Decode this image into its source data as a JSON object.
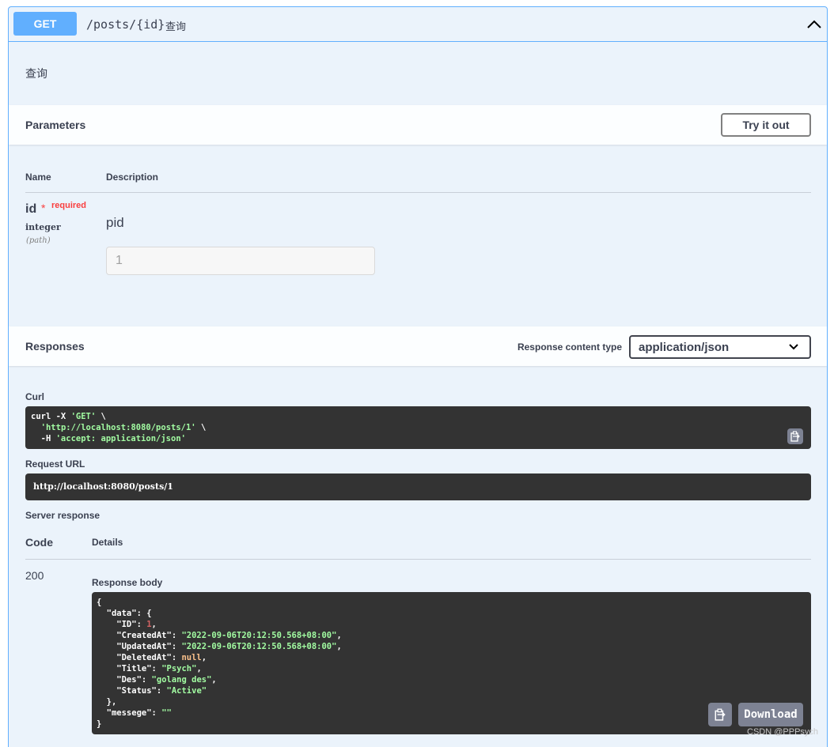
{
  "operation": {
    "method": "GET",
    "path": "/posts/{id}",
    "summary": "查询",
    "description": "查询"
  },
  "parameters": {
    "title": "Parameters",
    "try_it_out": "Try it out",
    "col_name": "Name",
    "col_description": "Description",
    "items": [
      {
        "name": "id",
        "required_star": "*",
        "required_label": "required",
        "type": "integer",
        "in": "(path)",
        "description": "pid",
        "value": "1"
      }
    ]
  },
  "responses": {
    "title": "Responses",
    "content_type_label": "Response content type",
    "content_type": "application/json",
    "curl_label": "Curl",
    "curl_line1_a": "curl -X ",
    "curl_line1_b": "'GET'",
    "curl_line1_c": " \\",
    "curl_line2_a": "  ",
    "curl_line2_b": "'http://localhost:8080/posts/1'",
    "curl_line2_c": " \\",
    "curl_line3_a": "  -H ",
    "curl_line3_b": "'accept: application/json'",
    "request_url_label": "Request URL",
    "request_url": "http://localhost:8080/posts/1",
    "server_response_label": "Server response",
    "col_code": "Code",
    "col_details": "Details",
    "code": "200",
    "response_body_label": "Response body",
    "download": "Download",
    "body": {
      "data": {
        "ID": "1",
        "CreatedAt": "\"2022-09-06T20:12:50.568+08:00\"",
        "UpdatedAt": "\"2022-09-06T20:12:50.568+08:00\"",
        "DeletedAt": "null",
        "Title": "\"Psych\"",
        "Des": "\"golang des\"",
        "Status": "\"Active\""
      },
      "messege": "\"\""
    }
  },
  "watermark": "CSDN @PPPsych",
  "colors": {
    "get_accent": "#61affe",
    "required": "#f93e3e",
    "code_bg": "#333333",
    "string": "#a2fca2",
    "number": "#d36363",
    "null": "#fcc28c"
  },
  "icons": [
    "chevron-up-icon",
    "chevron-down-icon",
    "copy-icon"
  ]
}
